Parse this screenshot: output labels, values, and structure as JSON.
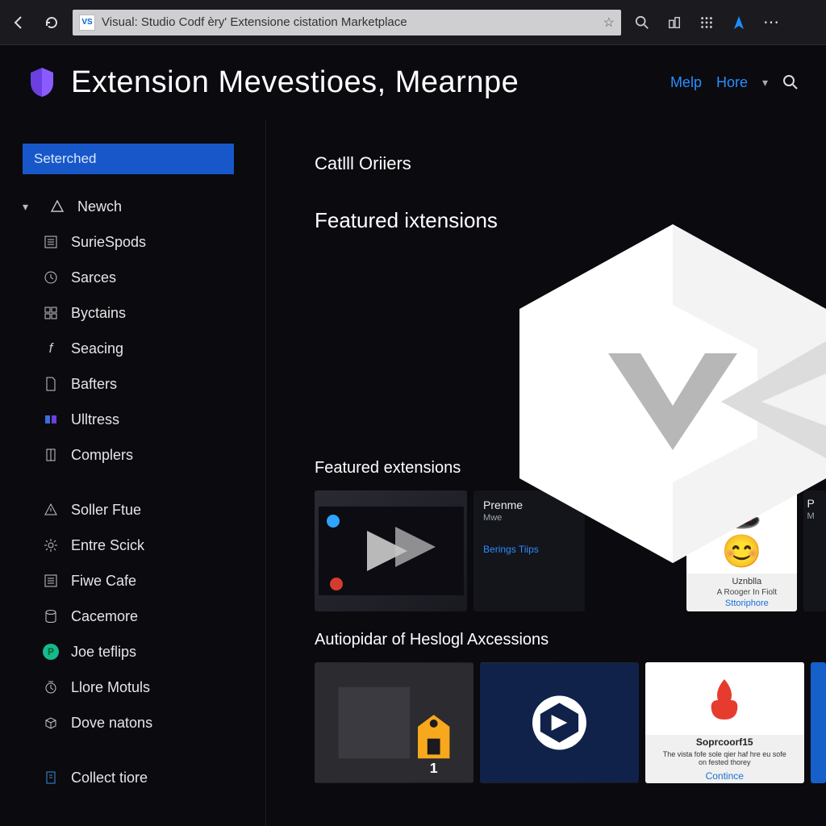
{
  "browser": {
    "url_text": "Visual: Studio Codf èry' Extensione cistation Marketplace",
    "favicon_text": "VS"
  },
  "header": {
    "title": "Extension Mevestioes, Mearnpe",
    "links": {
      "melp": "Melp",
      "hore": "Hore"
    }
  },
  "sidebar": {
    "filter_label": "Seterched",
    "group1_label": "Newch",
    "items1": [
      "SurieSpods",
      "Sarces",
      "Byctains",
      "Seacing",
      "Bafters",
      "Ulltress",
      "Complers"
    ],
    "items2": [
      "Soller Ftue",
      "Entre Scick",
      "Fiwe Cafe",
      "Cacemore",
      "Joe teflips",
      "Llore Motuls",
      "Dove natons"
    ],
    "items3": [
      "Collect tiore"
    ]
  },
  "content": {
    "heading_catl": "Catlll Oriiers",
    "heading_featured": "Featured ixtensions",
    "heading_featured2": "Featured extensions",
    "heading_auto": "Autiopidar of Heslogl Axcessions",
    "card1": {
      "title": "Prenme",
      "sub": "Mwe",
      "link": "Berings Tiips"
    },
    "card2": {
      "l1": "Uznblla",
      "l2": "A Rooger In Fiolt",
      "l3": "Sttoriphore"
    },
    "card2b": {
      "p": "P",
      "m": "M"
    },
    "row2_card3": {
      "name": "Soprcoorf15",
      "desc": "The vista fofe sole qier haf hre eu sofe on fested thorey",
      "link": "Contince"
    }
  },
  "colors": {
    "accent_blue": "#2b8dff",
    "filter_bg": "#1757c9"
  }
}
